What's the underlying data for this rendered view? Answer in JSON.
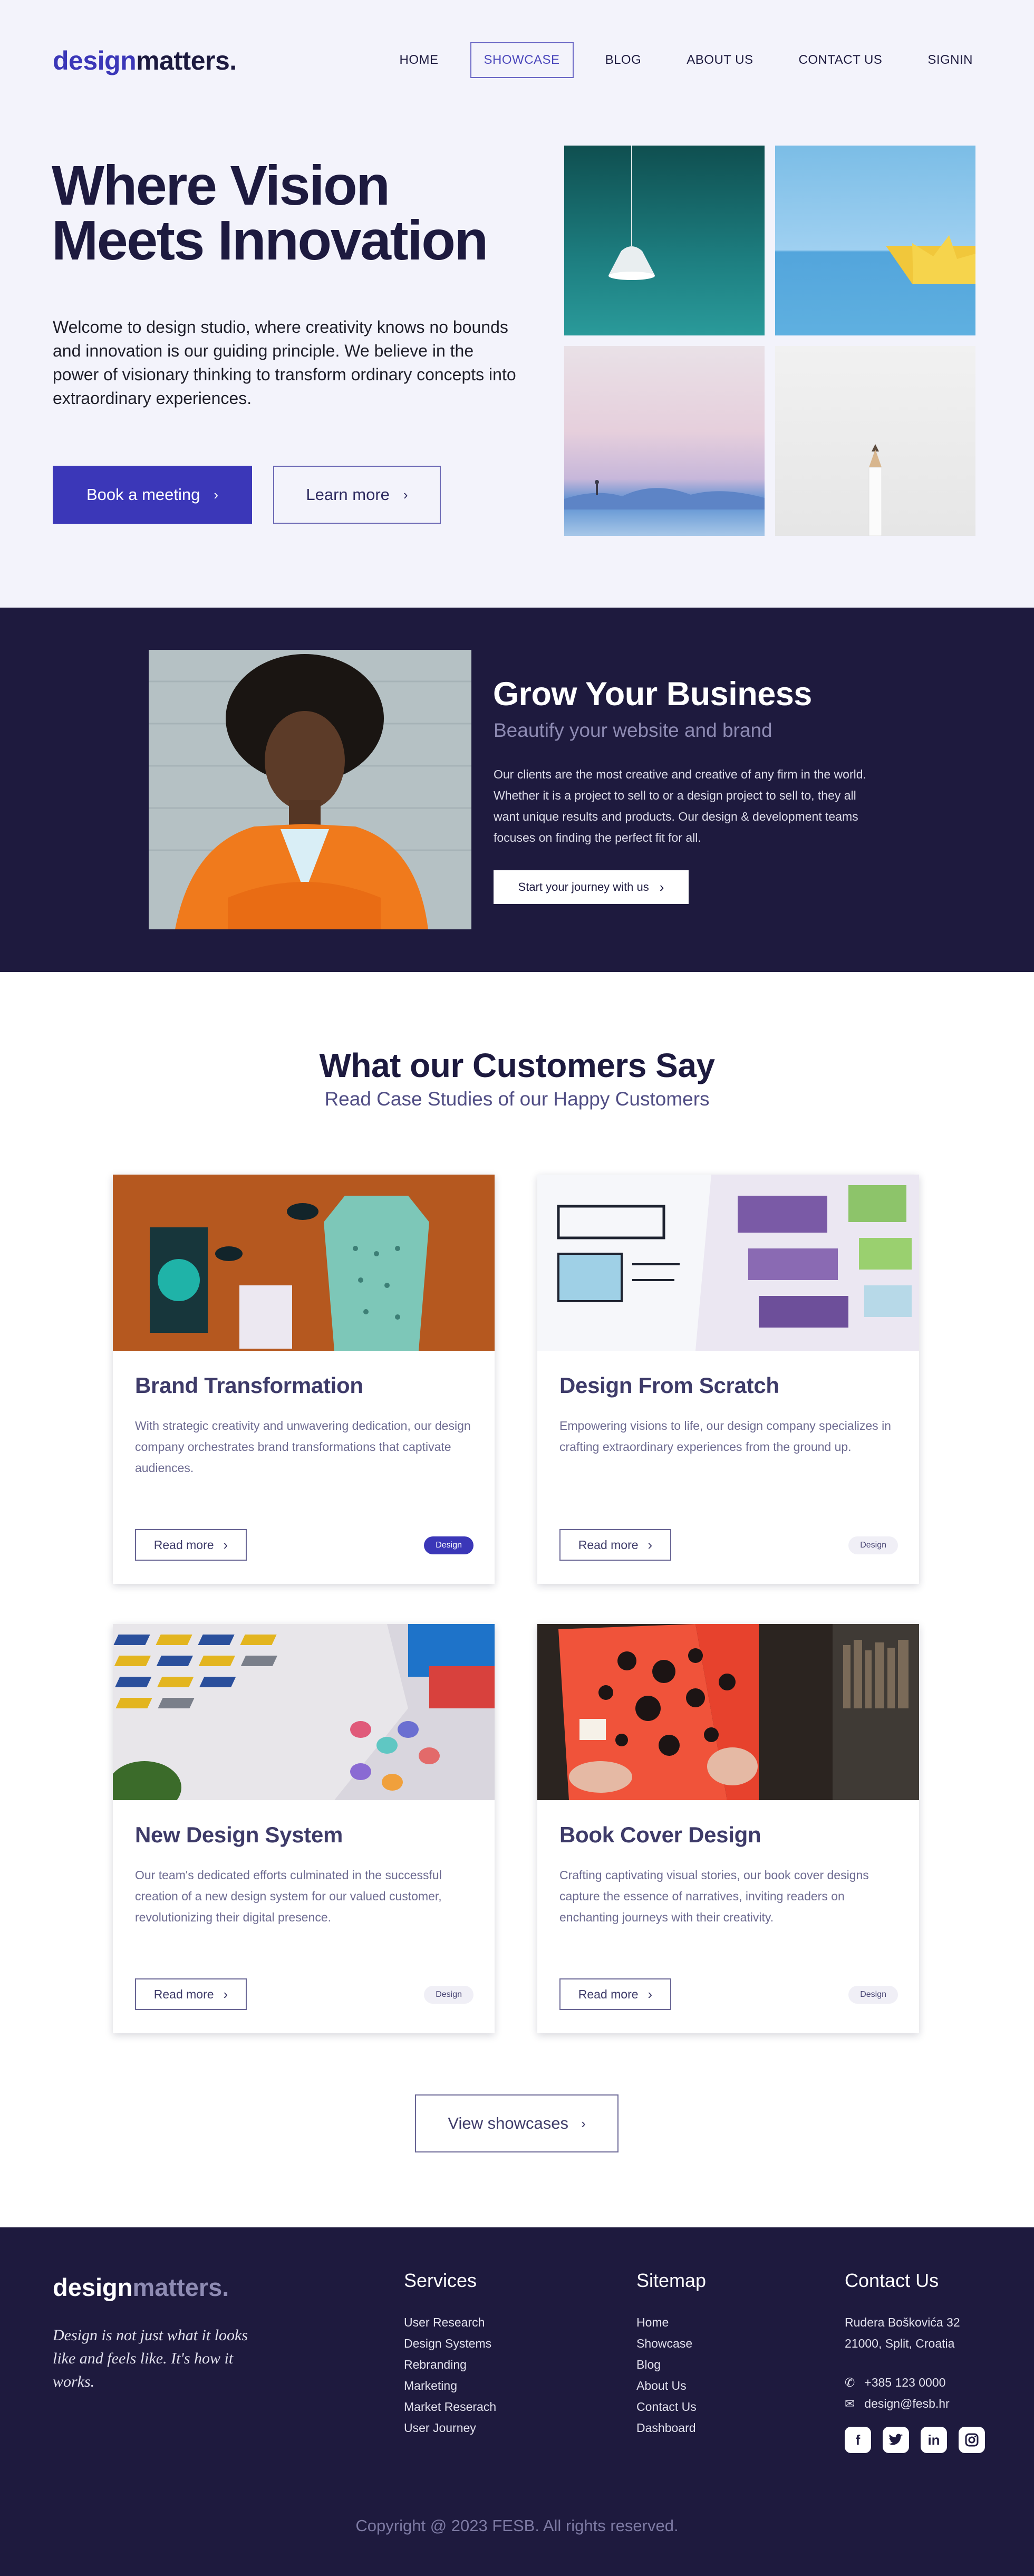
{
  "brand": {
    "logo_part1": "design",
    "logo_part2": "matters."
  },
  "nav": {
    "items": [
      {
        "label": "HOME",
        "active": false
      },
      {
        "label": "SHOWCASE",
        "active": true
      },
      {
        "label": "BLOG",
        "active": false
      },
      {
        "label": "ABOUT US",
        "active": false
      },
      {
        "label": "CONTACT US",
        "active": false
      },
      {
        "label": "SIGNIN",
        "active": false
      }
    ]
  },
  "hero": {
    "title_line1": "Where Vision",
    "title_line2": "Meets Innovation",
    "text": "Welcome to design studio, where creativity knows no bounds and innovation is our guiding principle. We believe in the power of visionary thinking to transform ordinary concepts into extraordinary experiences.",
    "primary_button": "Book a meeting",
    "secondary_button": "Learn more"
  },
  "grow": {
    "title": "Grow Your Business",
    "subtitle": "Beautify your website and brand",
    "text": "Our clients are the most creative and creative of any firm in the world. Whether it is a project to sell to or a design project to sell to, they all want unique results and products. Our design & development teams focuses on finding the perfect fit for all.",
    "button": "Start your journey with us"
  },
  "customers": {
    "title": "What our Customers Say",
    "subtitle": "Read Case Studies of our Happy Customers",
    "cards": [
      {
        "title": "Brand Transformation",
        "text": "With strategic creativity and unwavering dedication, our design company orchestrates brand transformations that captivate audiences.",
        "button": "Read more",
        "tag": "Design",
        "tag_active": true
      },
      {
        "title": "Design From Scratch",
        "text": "Empowering visions to life, our design company specializes in crafting extraordinary experiences from the ground up.",
        "button": "Read more",
        "tag": "Design",
        "tag_active": false
      },
      {
        "title": "New Design System",
        "text": "Our team's dedicated efforts culminated in the successful creation of a new design system for our valued customer, revolutionizing their digital presence.",
        "button": "Read more",
        "tag": "Design",
        "tag_active": false
      },
      {
        "title": "Book Cover Design",
        "text": "Crafting captivating visual stories, our book cover designs capture the essence of narratives, inviting readers on enchanting journeys with their creativity.",
        "button": "Read more",
        "tag": "Design",
        "tag_active": false
      }
    ],
    "showcase_button": "View showcases"
  },
  "footer": {
    "logo_part1": "design",
    "logo_part2": "matters.",
    "tagline": "Design is not just what it looks like and feels like. It's how it works.",
    "services": {
      "title": "Services",
      "items": [
        "User Research",
        "Design Systems",
        "Rebranding",
        "Marketing",
        "Market Reserach",
        "User Journey"
      ]
    },
    "sitemap": {
      "title": "Sitemap",
      "items": [
        "Home",
        "Showcase",
        "Blog",
        "About Us",
        "Contact Us",
        "Dashboard"
      ]
    },
    "contact": {
      "title": "Contact Us",
      "address_line1": "Rudera Boškovića 32",
      "address_line2": "21000, Split, Croatia",
      "phone": "+385 123 0000",
      "email": "design@fesb.hr"
    },
    "socials": [
      "facebook-icon",
      "twitter-icon",
      "linkedin-icon",
      "instagram-icon"
    ],
    "copyright": "Copyright @ 2023 FESB. All rights reserved."
  },
  "colors": {
    "accent": "#3b37b8",
    "dark": "#1e1a3e",
    "hero_bg": "#f3f3fb"
  }
}
